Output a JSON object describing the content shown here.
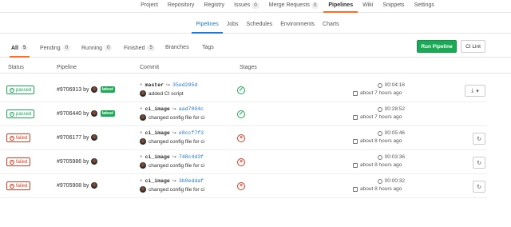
{
  "top_nav": [
    {
      "label": "Project",
      "count": "",
      "active": false
    },
    {
      "label": "Repository",
      "count": "",
      "active": false
    },
    {
      "label": "Registry",
      "count": "",
      "active": false
    },
    {
      "label": "Issues",
      "count": "0",
      "active": false
    },
    {
      "label": "Merge Requests",
      "count": "0",
      "active": false
    },
    {
      "label": "Pipelines",
      "count": "",
      "active": true
    },
    {
      "label": "Wiki",
      "count": "",
      "active": false
    },
    {
      "label": "Snippets",
      "count": "",
      "active": false
    },
    {
      "label": "Settings",
      "count": "",
      "active": false
    }
  ],
  "sub_nav": [
    {
      "label": "Pipelines",
      "active": true
    },
    {
      "label": "Jobs",
      "active": false
    },
    {
      "label": "Schedules",
      "active": false
    },
    {
      "label": "Environments",
      "active": false
    },
    {
      "label": "Charts",
      "active": false
    }
  ],
  "scopes": [
    {
      "label": "All",
      "count": "5",
      "active": true
    },
    {
      "label": "Pending",
      "count": "0",
      "active": false
    },
    {
      "label": "Running",
      "count": "0",
      "active": false
    },
    {
      "label": "Finished",
      "count": "5",
      "active": false
    },
    {
      "label": "Branches",
      "count": "",
      "active": false
    },
    {
      "label": "Tags",
      "count": "",
      "active": false
    }
  ],
  "buttons": {
    "run_pipeline": "Run Pipeline",
    "ci_lint": "CI Lint"
  },
  "table": {
    "headers": {
      "status": "Status",
      "pipeline": "Pipeline",
      "commit": "Commit",
      "stages": "Stages"
    },
    "rows": [
      {
        "status": "passed",
        "status_label": "passed",
        "pipeline_id": "#9706913",
        "by": "by",
        "latest": "latest",
        "branch": "master",
        "sha": "35ed295d",
        "message": "added CI script",
        "stage": "passed",
        "duration": "00:04:16",
        "finished": "about 7 hours ago",
        "action": "download"
      },
      {
        "status": "passed",
        "status_label": "passed",
        "pipeline_id": "#9706440",
        "by": "by",
        "latest": "latest",
        "branch": "ci_image",
        "sha": "aad7004c",
        "message": "changed config file for ci",
        "stage": "passed",
        "duration": "00:28:52",
        "finished": "about 7 hours ago",
        "action": "none"
      },
      {
        "status": "failed",
        "status_label": "failed",
        "pipeline_id": "#9706177",
        "by": "by",
        "latest": "",
        "branch": "ci_image",
        "sha": "e8ccf7f3",
        "message": "changed config file for ci",
        "stage": "failed",
        "duration": "00:05:46",
        "finished": "about 8 hours ago",
        "action": "retry"
      },
      {
        "status": "failed",
        "status_label": "failed",
        "pipeline_id": "#9705986",
        "by": "by",
        "latest": "",
        "branch": "ci_image",
        "sha": "748c4d3f",
        "message": "changed config file for ci",
        "stage": "failed",
        "duration": "00:03:36",
        "finished": "about 8 hours ago",
        "action": "retry"
      },
      {
        "status": "failed",
        "status_label": "failed",
        "pipeline_id": "#9705908",
        "by": "by",
        "latest": "",
        "branch": "ci_image",
        "sha": "3b0eddaf",
        "message": "changed config file for ci",
        "stage": "failed",
        "duration": "00:00:32",
        "finished": "about 8 hours ago",
        "action": "retry"
      }
    ]
  },
  "colors": {
    "success": "#1aaa55",
    "danger": "#db3b21",
    "link": "#1f78d1",
    "active_tab": "#fc6d26"
  }
}
